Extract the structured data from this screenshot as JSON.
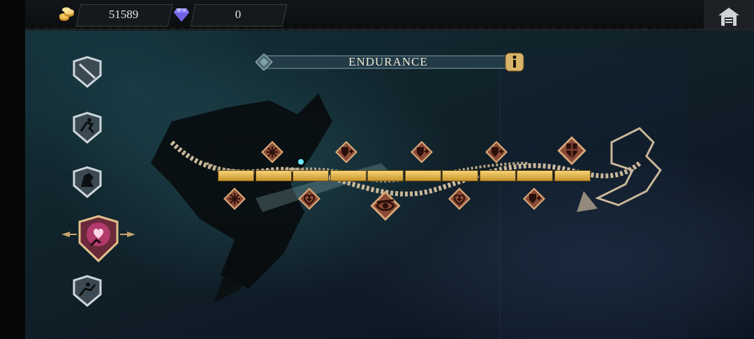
{
  "topbar": {
    "gold": {
      "icon": "gold-coins-icon",
      "value": "51589"
    },
    "gems": {
      "icon": "diamond-icon",
      "value": "0"
    },
    "home": {
      "icon": "home-icon"
    }
  },
  "skill_tabs": [
    {
      "name": "blade-skill-tab",
      "icon": "blade-icon",
      "selected": false
    },
    {
      "name": "dash-skill-tab",
      "icon": "runner-icon",
      "selected": false
    },
    {
      "name": "beast-skill-tab",
      "icon": "beast-icon",
      "selected": false
    },
    {
      "name": "endurance-skill-tab",
      "icon": "heart-hand-icon",
      "selected": true
    },
    {
      "name": "agility-skill-tab",
      "icon": "leap-icon",
      "selected": false
    }
  ],
  "title": "ENDURANCE",
  "info_icon": "info-icon",
  "progress": {
    "segments_filled": 10,
    "segments_total": 10
  },
  "skill_nodes_top": [
    {
      "icon": "snowflake-icon"
    },
    {
      "icon": "shield-plus-icon"
    },
    {
      "icon": "shield-plus-icon"
    },
    {
      "icon": "shield-plus-icon"
    },
    {
      "icon": "shield-figure-icon"
    }
  ],
  "skill_nodes_bottom": [
    {
      "icon": "snowflake-icon"
    },
    {
      "icon": "heart-plus-icon"
    },
    {
      "icon": "eye-icon"
    },
    {
      "icon": "heart-plus-icon"
    },
    {
      "icon": "shield-plus-icon"
    }
  ],
  "colors": {
    "gold": "#f2c35a",
    "node_fill": "#3a1e17",
    "node_border": "#d9a878",
    "accent_pink": "#e05a8f"
  }
}
